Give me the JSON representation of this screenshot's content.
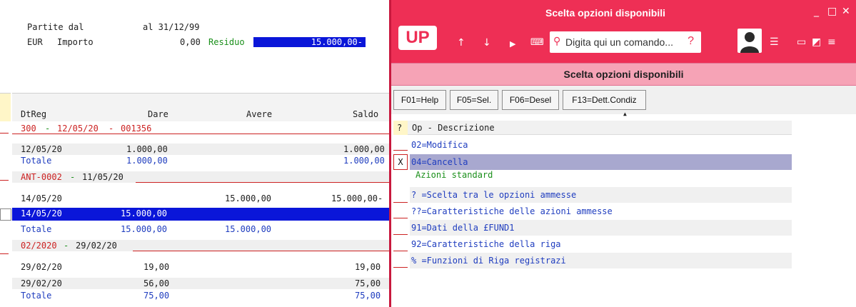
{
  "left": {
    "header": {
      "partite_label": "Partite dal",
      "al_label": "al 31/12/99",
      "currency": "EUR",
      "importo_label": "Importo",
      "importo_value": "0,00",
      "residuo_label": "Residuo",
      "residuo_value": "15.000,00-"
    },
    "columns": {
      "dtreg": "DtReg",
      "dare": "Dare",
      "avere": "Avere",
      "saldo": "Saldo"
    },
    "groups": [
      {
        "code": "300",
        "sep": "-",
        "date": "12/05/20",
        "sep2": "-",
        "ref": "001356",
        "rows": [
          {
            "dtreg": "12/05/20",
            "dare": "1.000,00",
            "avere": "",
            "saldo": "1.000,00"
          }
        ],
        "total": {
          "label": "Totale",
          "dare": "1.000,00",
          "avere": "",
          "saldo": "1.000,00"
        }
      },
      {
        "code": "ANT-0002",
        "sep": "-",
        "date": "11/05/20",
        "rows": [
          {
            "dtreg": "14/05/20",
            "dare": "",
            "avere": "15.000,00",
            "saldo": "15.000,00-"
          },
          {
            "dtreg": "14/05/20",
            "dare": "15.000,00",
            "avere": "",
            "saldo": ""
          }
        ],
        "total": {
          "label": "Totale",
          "dare": "15.000,00",
          "avere": "15.000,00",
          "saldo": ""
        }
      },
      {
        "code": "02/2020",
        "sep": "-",
        "date": "29/02/20",
        "rows": [
          {
            "dtreg": "29/02/20",
            "dare": "19,00",
            "avere": "",
            "saldo": "19,00"
          },
          {
            "dtreg": "29/02/20",
            "dare": "56,00",
            "avere": "",
            "saldo": "75,00"
          }
        ],
        "total": {
          "label": "Totale",
          "dare": "75,00",
          "avere": "",
          "saldo": "75,00"
        }
      }
    ]
  },
  "dialog": {
    "title": "Scelta opzioni disponibili",
    "logo": "UP",
    "search_placeholder": "Digita qui un comando...",
    "search_help": "?",
    "subtitle": "Scelta opzioni disponibili",
    "fkeys": [
      "F01=Help",
      "F05=Sel.",
      "F06=Desel",
      "F13=Dett.Condiz"
    ],
    "list_header": {
      "q": "?",
      "label": "Op - Descrizione"
    },
    "options": [
      {
        "label": "02=Modifica",
        "mark": ""
      },
      {
        "label": "04=Cancella",
        "mark": "X"
      },
      {
        "label": "Azioni standard",
        "mark": ""
      },
      {
        "label": "? =Scelta tra le opzioni ammesse",
        "mark": ""
      },
      {
        "label": "??=Caratteristiche delle azioni ammesse",
        "mark": ""
      },
      {
        "label": "91=Dati della £FUND1",
        "mark": ""
      },
      {
        "label": "92=Caratteristiche della riga",
        "mark": ""
      },
      {
        "label": "% =Funzioni di Riga registrazi",
        "mark": ""
      }
    ],
    "colors": {
      "accent": "#ee2f55",
      "subtitle_bg": "#f6a3b6",
      "selection": "#a8a8cf"
    }
  }
}
